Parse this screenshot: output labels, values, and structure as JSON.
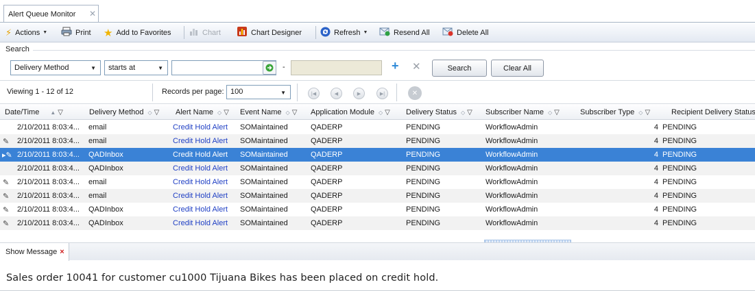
{
  "window_tab": {
    "title": "Alert Queue Monitor",
    "close": "✕"
  },
  "toolbar": {
    "actions": "Actions",
    "print": "Print",
    "favorites": "Add to Favorites",
    "chart": "Chart",
    "chart_designer": "Chart Designer",
    "refresh": "Refresh",
    "resend_all": "Resend All",
    "delete_all": "Delete All"
  },
  "search": {
    "legend": "Search",
    "field": "Delivery Method",
    "operator": "starts at",
    "value": "",
    "dash": "-",
    "search_button": "Search",
    "clear_button": "Clear All"
  },
  "pager": {
    "viewing": "Viewing 1 - 12 of 12",
    "records_label": "Records per page:",
    "records_value": "100"
  },
  "grid": {
    "columns": [
      "Date/Time",
      "Delivery Method",
      "Alert Name",
      "Event Name",
      "Application Module",
      "Delivery Status",
      "Subscriber Name",
      "Subscriber Type",
      "Recipient Delivery Status"
    ],
    "rows": [
      {
        "mark": "",
        "datetime": "2/10/2011 8:03:4...",
        "delivery": "email",
        "alert": "Credit Hold Alert",
        "event": "SOMaintained",
        "module": "QADERP",
        "status": "PENDING",
        "subscriber": "WorkflowAdmin",
        "type": "4",
        "recipient": "PENDING"
      },
      {
        "mark": "✎",
        "datetime": "2/10/2011 8:03:4...",
        "delivery": "email",
        "alert": "Credit Hold Alert",
        "event": "SOMaintained",
        "module": "QADERP",
        "status": "PENDING",
        "subscriber": "WorkflowAdmin",
        "type": "4",
        "recipient": "PENDING"
      },
      {
        "mark": "▸✎",
        "datetime": "2/10/2011 8:03:4...",
        "delivery": "QADInbox",
        "alert": "Credit Hold Alert",
        "event": "SOMaintained",
        "module": "QADERP",
        "status": "PENDING",
        "subscriber": "WorkflowAdmin",
        "type": "4",
        "recipient": "PENDING"
      },
      {
        "mark": "",
        "datetime": "2/10/2011 8:03:4...",
        "delivery": "QADInbox",
        "alert": "Credit Hold Alert",
        "event": "SOMaintained",
        "module": "QADERP",
        "status": "PENDING",
        "subscriber": "WorkflowAdmin",
        "type": "4",
        "recipient": "PENDING"
      },
      {
        "mark": "✎",
        "datetime": "2/10/2011 8:03:4...",
        "delivery": "email",
        "alert": "Credit Hold Alert",
        "event": "SOMaintained",
        "module": "QADERP",
        "status": "PENDING",
        "subscriber": "WorkflowAdmin",
        "type": "4",
        "recipient": "PENDING"
      },
      {
        "mark": "✎",
        "datetime": "2/10/2011 8:03:4...",
        "delivery": "email",
        "alert": "Credit Hold Alert",
        "event": "SOMaintained",
        "module": "QADERP",
        "status": "PENDING",
        "subscriber": "WorkflowAdmin",
        "type": "4",
        "recipient": "PENDING"
      },
      {
        "mark": "✎",
        "datetime": "2/10/2011 8:03:4...",
        "delivery": "QADInbox",
        "alert": "Credit Hold Alert",
        "event": "SOMaintained",
        "module": "QADERP",
        "status": "PENDING",
        "subscriber": "WorkflowAdmin",
        "type": "4",
        "recipient": "PENDING"
      },
      {
        "mark": "✎",
        "datetime": "2/10/2011 8:03:4...",
        "delivery": "QADInbox",
        "alert": "Credit Hold Alert",
        "event": "SOMaintained",
        "module": "QADERP",
        "status": "PENDING",
        "subscriber": "WorkflowAdmin",
        "type": "4",
        "recipient": "PENDING"
      }
    ]
  },
  "message_panel": {
    "tab_label": "Show Message",
    "close": "×",
    "text": "Sales order 10041 for customer cu1000 Tijuana Bikes has been placed on credit hold."
  },
  "colors": {
    "selection": "#3a82d6",
    "link": "#1f3fc4",
    "close_red": "#d02020"
  },
  "icons": {
    "actions": "lightning-icon",
    "print": "printer-icon",
    "favorites": "star-icon",
    "chart": "bar-chart-icon",
    "chart_designer": "chart-designer-icon",
    "refresh": "refresh-icon",
    "resend": "resend-icon",
    "delete": "delete-icon"
  }
}
